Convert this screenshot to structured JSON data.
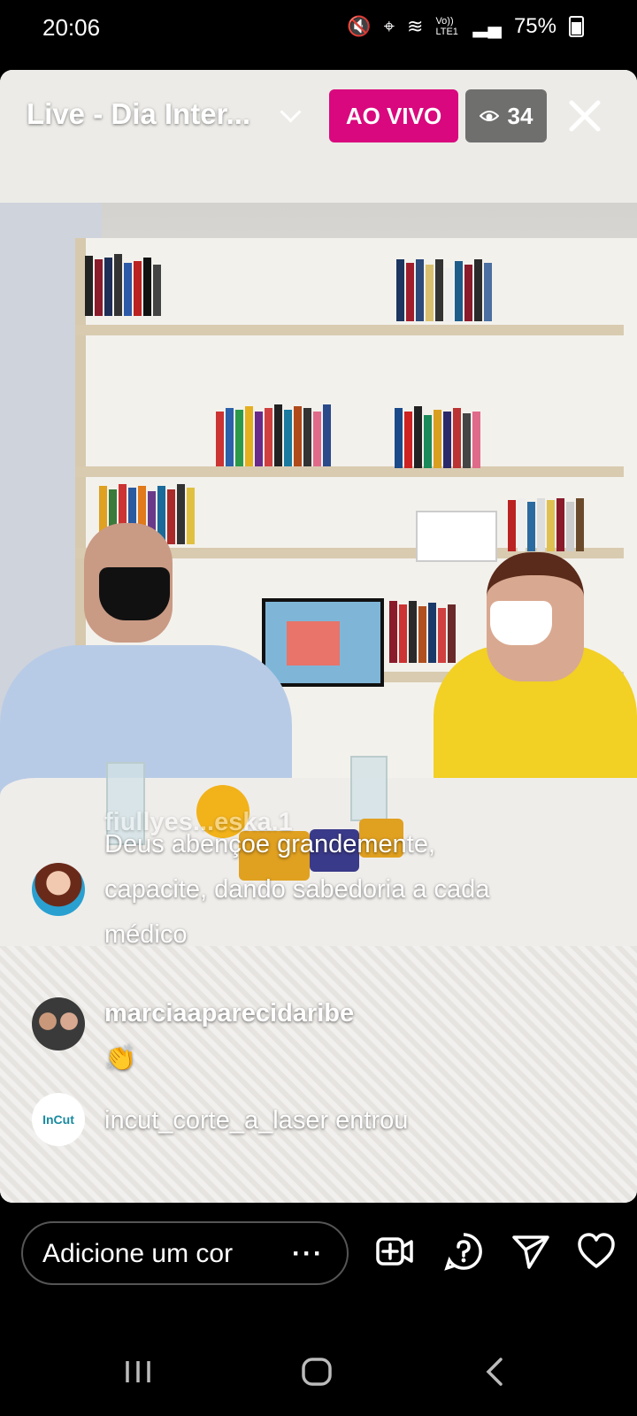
{
  "status": {
    "time": "20:06",
    "network": "Vo)) LTE1",
    "battery": "75%"
  },
  "live": {
    "title": "Live - Dia Inter...",
    "badge": "AO VIVO",
    "viewers": "34"
  },
  "comments": [
    {
      "user": "fiullyes...eska.1",
      "text": "Deus abençoe grandemente, capacite, dando sabedoria a cada médico"
    },
    {
      "user": "marciaaparecidaribe",
      "text": "👏"
    },
    {
      "user": "",
      "text": "incut_corte_a_laser entrou",
      "avatar_text": "InCut"
    }
  ],
  "compose": {
    "placeholder": "Adicione um cor",
    "more": "···"
  },
  "icons": [
    "add-video-icon",
    "question-icon",
    "send-icon",
    "heart-icon"
  ],
  "colors": {
    "live": "#d9087e",
    "background": "#000000"
  }
}
